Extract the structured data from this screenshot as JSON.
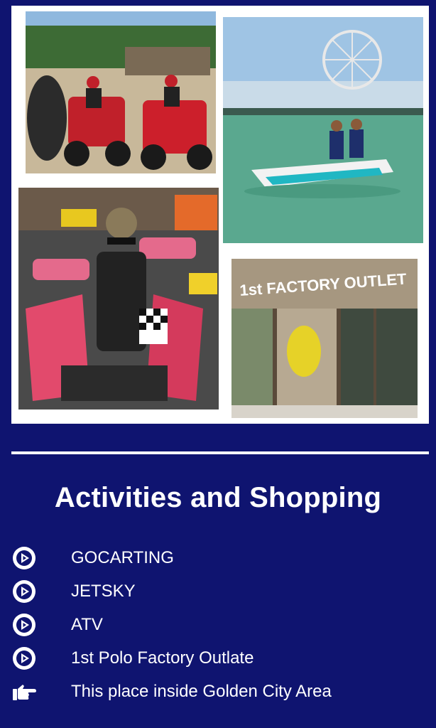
{
  "photos": [
    {
      "name": "atv-photo",
      "caption": ""
    },
    {
      "name": "jetski-photo",
      "caption": ""
    },
    {
      "name": "gokart-photo",
      "caption": ""
    },
    {
      "name": "outlet-photo",
      "sign_text": "1st FACTORY OUTLET"
    }
  ],
  "section": {
    "title": "Activities and Shopping"
  },
  "items": [
    {
      "icon": "play-circle-icon",
      "label": "GOCARTING"
    },
    {
      "icon": "play-circle-icon",
      "label": "JETSKY"
    },
    {
      "icon": "play-circle-icon",
      "label": "ATV"
    },
    {
      "icon": "play-circle-icon",
      "label": "1st Polo Factory Outlate"
    },
    {
      "icon": "pointing-hand-icon",
      "label": "This place inside Golden City Area"
    }
  ],
  "colors": {
    "background": "#0f1470",
    "text": "#ffffff"
  }
}
